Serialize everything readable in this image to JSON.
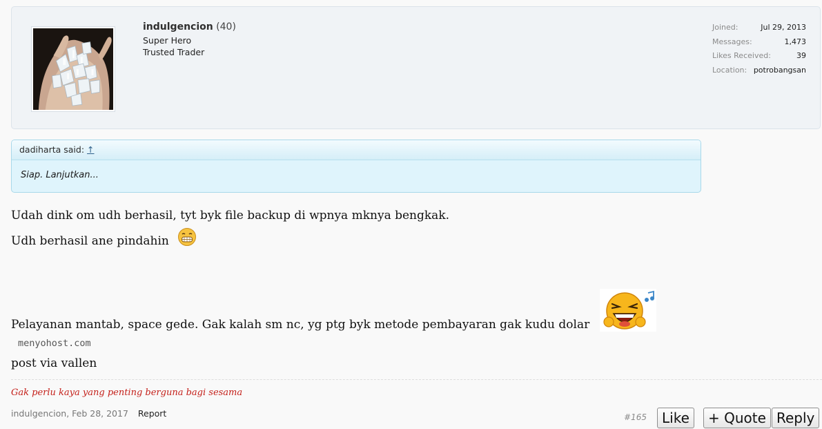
{
  "user": {
    "name": "indulgencion",
    "count": "(40)",
    "titles": [
      "Super Hero",
      "Trusted Trader"
    ]
  },
  "stats": [
    {
      "label": "Joined:",
      "value": "Jul 29, 2013"
    },
    {
      "label": "Messages:",
      "value": "1,473"
    },
    {
      "label": "Likes Received:",
      "value": "39"
    },
    {
      "label": "Location:",
      "value": "potrobangsan"
    }
  ],
  "quote": {
    "author_said": "dadiharta said:",
    "arrow": "↑",
    "text": "Siap. Lanjutkan..."
  },
  "message": {
    "line1": "Udah dink om udh berhasil, tyt byk file backup di wpnya mknya bengkak.",
    "line2": "Udh berhasil ane pindahin",
    "line3": "Pelayanan mantab, space gede. Gak kalah sm nc, yg ptg byk metode pembayaran gak kudu dolar",
    "mono": "menyohost.com",
    "line4": "post via vallen"
  },
  "signature": "Gak perlu kaya yang penting berguna bagi sesama",
  "footer": {
    "author_date": "indulgencion, Feb 28, 2017",
    "report": "Report",
    "post_number": "#165",
    "like": "Like",
    "quote": "+ Quote",
    "reply": "Reply"
  },
  "colors": {
    "signature": "#c4201a",
    "quote_bg": "#dff4fc",
    "card_bg": "#f0f3f6"
  }
}
